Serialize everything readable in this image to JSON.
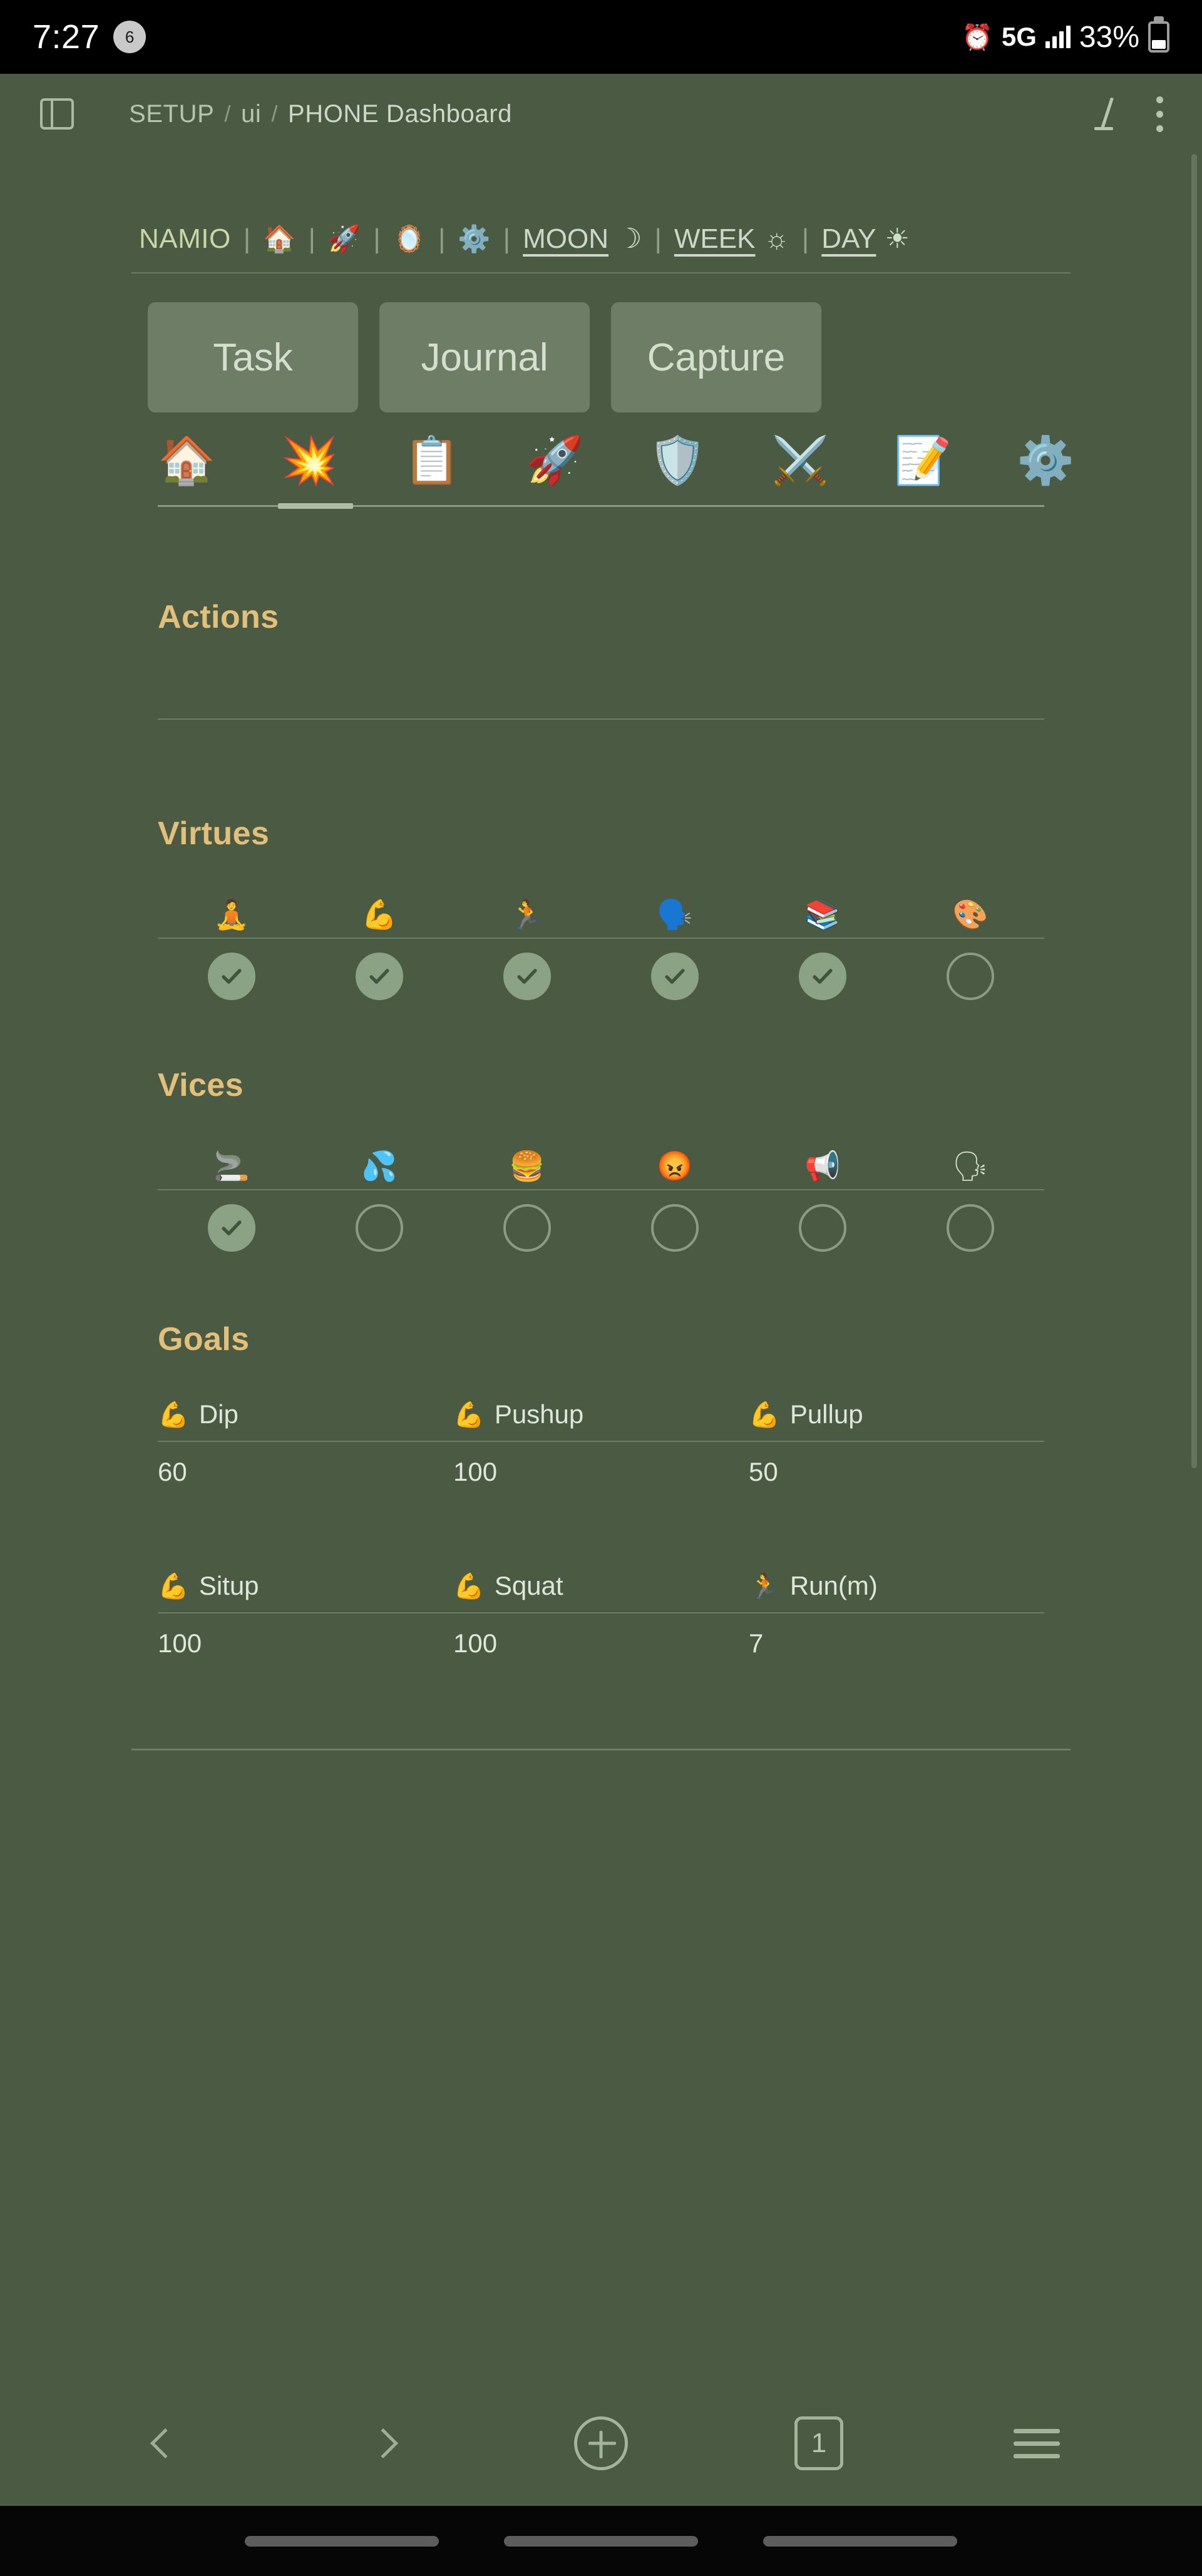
{
  "status_bar": {
    "time": "7:27",
    "notification_count": "6",
    "alarm_icon": "alarm-clock-icon",
    "network": "5G",
    "signal_icon": "signal-bars-icon",
    "battery_percent": "33%",
    "battery_icon": "battery-icon"
  },
  "header": {
    "sidebar_toggle_icon": "sidebar-toggle-icon",
    "breadcrumb": [
      "SETUP",
      "ui",
      "PHONE Dashboard"
    ],
    "separator": "/",
    "edit_icon": "pencil-icon",
    "more_icon": "kebab-menu-icon"
  },
  "mode_nav": {
    "brand": "NAMIO",
    "separator": "|",
    "icons": [
      {
        "name": "house-icon",
        "glyph": "🏠"
      },
      {
        "name": "rocket-icon",
        "glyph": "🚀"
      },
      {
        "name": "mirror-icon",
        "glyph": "🪞"
      },
      {
        "name": "gear-icon",
        "glyph": "⚙️"
      }
    ],
    "periods": [
      {
        "label": "MOON",
        "icon_name": "crescent-moon-icon",
        "icon": "☽"
      },
      {
        "label": "WEEK",
        "icon_name": "sun-behind-cloud-icon",
        "icon": "☼"
      },
      {
        "label": "DAY",
        "icon_name": "sun-icon",
        "icon": "☀"
      }
    ]
  },
  "action_buttons": [
    {
      "label": "Task",
      "name": "task-button"
    },
    {
      "label": "Journal",
      "name": "journal-button"
    },
    {
      "label": "Capture",
      "name": "capture-button"
    }
  ],
  "tab_strip": {
    "active_index": 1,
    "tabs": [
      {
        "name": "tab-home",
        "glyph": "🏠"
      },
      {
        "name": "tab-collision",
        "glyph": "💥"
      },
      {
        "name": "tab-clipboard",
        "glyph": "📋"
      },
      {
        "name": "tab-rocket",
        "glyph": "🚀"
      },
      {
        "name": "tab-shield",
        "glyph": "🛡️"
      },
      {
        "name": "tab-swords",
        "glyph": "⚔️"
      },
      {
        "name": "tab-memo",
        "glyph": "📝"
      },
      {
        "name": "tab-gear",
        "glyph": "⚙️"
      }
    ]
  },
  "sections": {
    "actions": {
      "title": "Actions",
      "items": []
    },
    "virtues": {
      "title": "Virtues",
      "items": [
        {
          "name": "virtue-meditation",
          "glyph": "🧘",
          "checked": true
        },
        {
          "name": "virtue-strength",
          "glyph": "💪",
          "checked": true
        },
        {
          "name": "virtue-running",
          "glyph": "🏃",
          "checked": true
        },
        {
          "name": "virtue-speaking",
          "glyph": "🗣️",
          "checked": true
        },
        {
          "name": "virtue-reading",
          "glyph": "📚",
          "checked": true
        },
        {
          "name": "virtue-art",
          "glyph": "🎨",
          "checked": false
        }
      ]
    },
    "vices": {
      "title": "Vices",
      "items": [
        {
          "name": "vice-smoking",
          "glyph": "🚬",
          "checked": true
        },
        {
          "name": "vice-lust",
          "glyph": "💦",
          "checked": false
        },
        {
          "name": "vice-junk-food",
          "glyph": "🍔",
          "checked": false
        },
        {
          "name": "vice-anger",
          "glyph": "😡",
          "checked": false
        },
        {
          "name": "vice-shouting",
          "glyph": "📢",
          "checked": false
        },
        {
          "name": "vice-gossip",
          "glyph": "🗣",
          "checked": false
        }
      ]
    },
    "goals": {
      "title": "Goals",
      "rows": [
        [
          {
            "name": "goal-dip",
            "glyph": "💪",
            "label": "Dip",
            "value": "60"
          },
          {
            "name": "goal-pushup",
            "glyph": "💪",
            "label": "Pushup",
            "value": "100"
          },
          {
            "name": "goal-pullup",
            "glyph": "💪",
            "label": "Pullup",
            "value": "50"
          }
        ],
        [
          {
            "name": "goal-situp",
            "glyph": "💪",
            "label": "Situp",
            "value": "100"
          },
          {
            "name": "goal-squat",
            "glyph": "💪",
            "label": "Squat",
            "value": "100"
          },
          {
            "name": "goal-run",
            "glyph": "🏃",
            "label": "Run(m)",
            "value": "7"
          }
        ]
      ]
    }
  },
  "bottom_nav": {
    "back_icon": "chevron-left-icon",
    "forward_icon": "chevron-right-icon",
    "add_icon": "plus-circle-icon",
    "tab_count": "1",
    "menu_icon": "hamburger-menu-icon"
  },
  "colors": {
    "background": "#4a5a43",
    "accent_gold": "#e2c07c",
    "button_bg": "#6e7d66",
    "check_fill": "#8ba384"
  }
}
